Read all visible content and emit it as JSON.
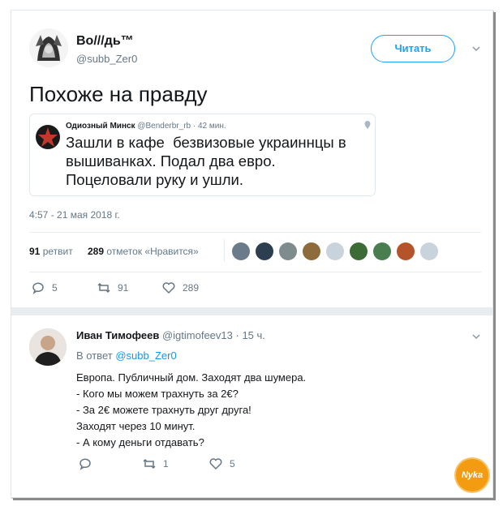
{
  "tweet": {
    "author_name": "Bo///дь™",
    "author_handle": "@subb_Zer0",
    "follow_label": "Читать",
    "text": "Похоже на правду",
    "timestamp": "4:57 - 21 мая 2018 г.",
    "retweet_count": "91",
    "retweet_label": "ретвит",
    "like_count": "289",
    "like_label": "отметок «Нравится»",
    "actions": {
      "replies": "5",
      "retweets": "91",
      "likes": "289"
    }
  },
  "quoted": {
    "author_name": "Одиозный Минск",
    "author_handle": "@Benderbr_rb",
    "time": "· 42 мин.",
    "text_lines": [
      "Зашли в кафе  безвизовые украиннцы в",
      "вышиванках. Подал два евро.",
      "Поцеловали руку и ушли."
    ]
  },
  "reply": {
    "author_name": "Иван Тимофеев",
    "author_handle": "@igtimofeev13",
    "time": "· 15 ч.",
    "in_reply_prefix": "В ответ",
    "in_reply_to": "@subb_Zer0",
    "text_lines": [
      "Европа. Публичный дом. Заходят два шумера.",
      "- Кого мы можем трахнуть за 2€?",
      "- За 2€ можете трахнуть друг друга!",
      "Заходят через 10 минут.",
      "- А кому деньги отдавать?"
    ],
    "actions": {
      "replies": "",
      "retweets": "1",
      "likes": "5"
    }
  },
  "watermark": "Nyka",
  "colors": {
    "accent": "#1da1f2",
    "muted": "#657786",
    "border": "#e1e8ed",
    "quote_star": "#c0392b",
    "watermark_bg": "#f39c12"
  }
}
